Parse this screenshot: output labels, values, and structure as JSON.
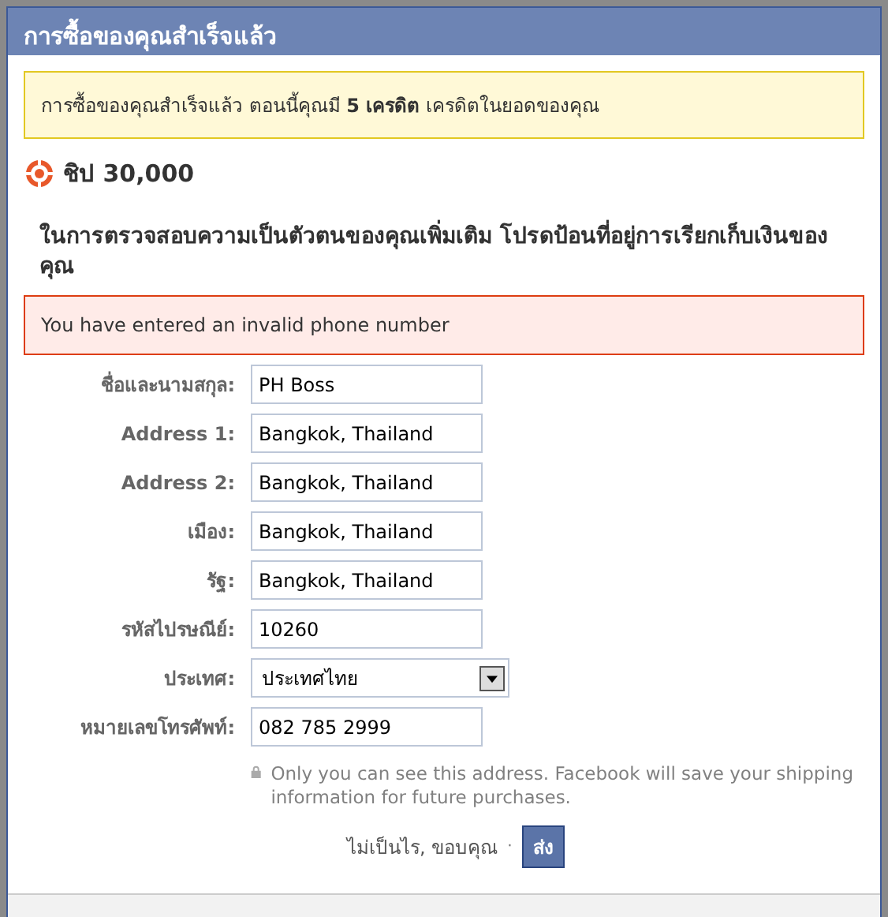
{
  "dialog": {
    "title": "การซื้อของคุณสำเร็จแล้ว"
  },
  "notice": "การซื้อของคุณสำเร็จแล้ว ตอนนี้คุณมี **5 เครดิต** เครดิตในยอดของคุณ",
  "product": {
    "name": "ชิป 30,000"
  },
  "instructions": "ในการตรวจสอบความเป็นตัวตนของคุณเพิ่มเติม โปรดป้อนที่อยู่การเรียกเก็บเงินของคุณ",
  "error": "You have entered an invalid phone number",
  "fields": [
    {
      "kind": "text",
      "label": "ชื่อและนามสกุล:",
      "value": "PH Boss"
    },
    {
      "kind": "text",
      "label": "Address 1:",
      "value": "Bangkok, Thailand"
    },
    {
      "kind": "text",
      "label": "Address 2:",
      "value": "Bangkok, Thailand"
    },
    {
      "kind": "text",
      "label": "เมือง:",
      "value": "Bangkok, Thailand"
    },
    {
      "kind": "text",
      "label": "รัฐ:",
      "value": "Bangkok, Thailand"
    },
    {
      "kind": "text",
      "label": "รหัสไปรษณีย์:",
      "value": "10260"
    },
    {
      "kind": "select",
      "label": "ประเทศ:",
      "value": "ประเทศไทย"
    },
    {
      "kind": "text",
      "label": "หมายเลขโทรศัพท์:",
      "value": "082 785 2999"
    }
  ],
  "privacy_note": "Only you can see this address. Facebook will save your shipping information for future purchases.",
  "actions": {
    "cancel": "ไม่เป็นไร, ขอบคุณ",
    "separator": "·",
    "submit": "ส่ง"
  }
}
